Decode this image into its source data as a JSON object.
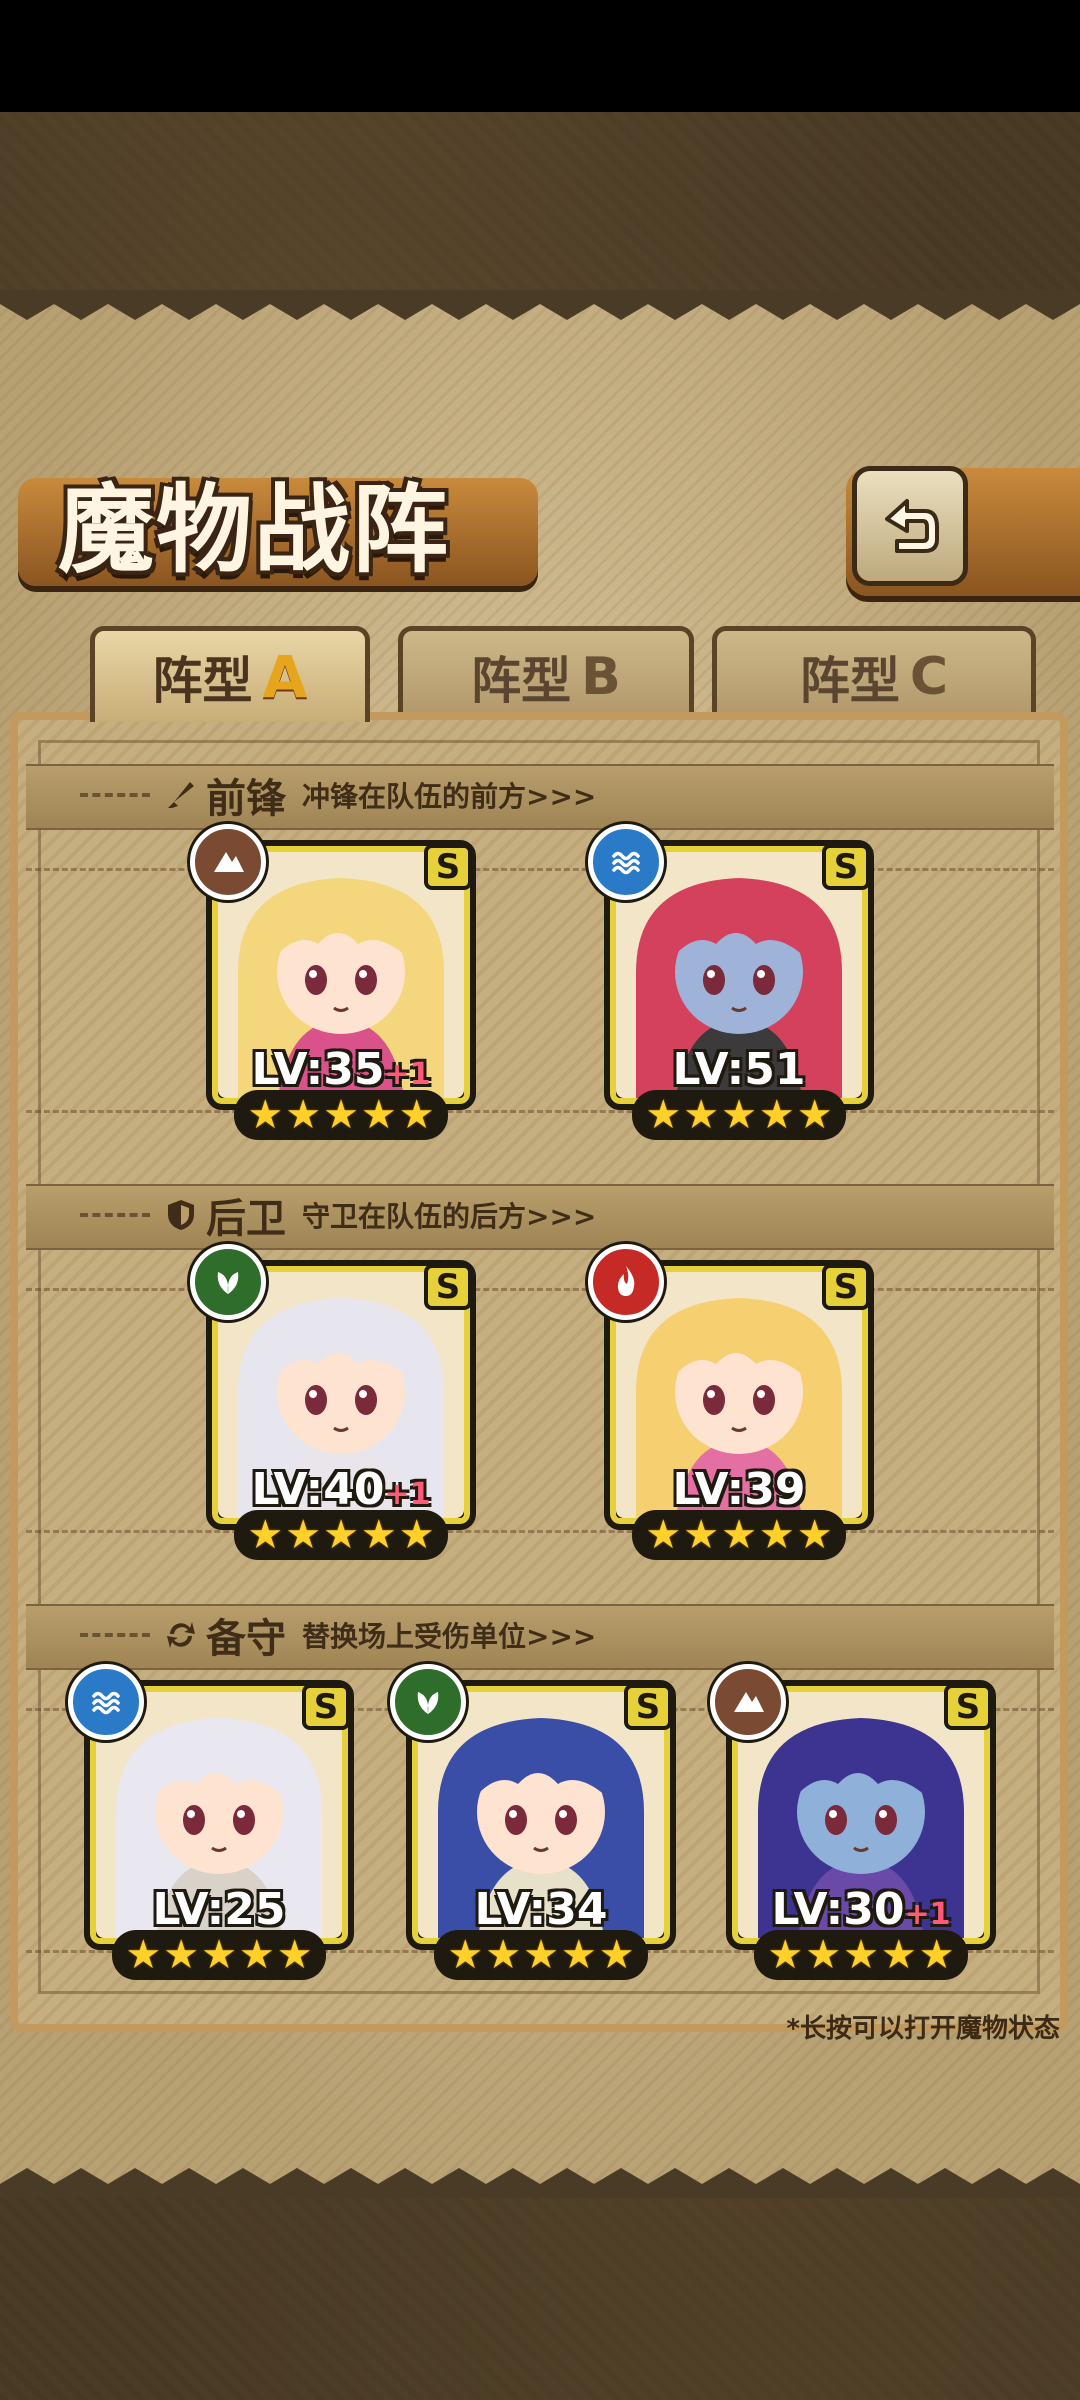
{
  "title": "魔物战阵",
  "back_icon": "back-arrow-icon",
  "tabs": [
    {
      "label": "阵型",
      "letter": "A",
      "active": true
    },
    {
      "label": "阵型",
      "letter": "B",
      "active": false
    },
    {
      "label": "阵型",
      "letter": "C",
      "active": false
    }
  ],
  "sections": {
    "front": {
      "name": "前锋",
      "desc": "冲锋在队伍的前方>>>",
      "icon": "sword-icon"
    },
    "rear": {
      "name": "后卫",
      "desc": "守卫在队伍的后方>>>",
      "icon": "shield-icon"
    },
    "reserve": {
      "name": "备守",
      "desc": "替换场上受伤单位>>>",
      "icon": "swap-icon"
    }
  },
  "units": {
    "front": [
      {
        "level": "LV:35",
        "plus": "+1",
        "rank": "S",
        "element": "earth",
        "stars": 5,
        "hair": "#f4d77c",
        "skin": "#fde3d0",
        "outfit": "#d9538a"
      },
      {
        "level": "LV:51",
        "plus": "",
        "rank": "S",
        "element": "water",
        "stars": 5,
        "hair": "#d4415d",
        "skin": "#9fb3d8",
        "outfit": "#3d3a3c"
      }
    ],
    "rear": [
      {
        "level": "LV:40",
        "plus": "+1",
        "rank": "S",
        "element": "wood",
        "stars": 5,
        "hair": "#e7e6ee",
        "skin": "#fde3d0",
        "outfit": "#e9e5ea"
      },
      {
        "level": "LV:39",
        "plus": "",
        "rank": "S",
        "element": "fire",
        "stars": 5,
        "hair": "#f6cf70",
        "skin": "#fde3d0",
        "outfit": "#e46fa3"
      }
    ],
    "reserve": [
      {
        "level": "LV:25",
        "plus": "",
        "rank": "S",
        "element": "water",
        "stars": 5,
        "hair": "#e9e7ef",
        "skin": "#fde3d0",
        "outfit": "#d8d2c8"
      },
      {
        "level": "LV:34",
        "plus": "",
        "rank": "S",
        "element": "wood",
        "stars": 5,
        "hair": "#3a4ea8",
        "skin": "#fde3d0",
        "outfit": "#e6e1c8"
      },
      {
        "level": "LV:30",
        "plus": "+1",
        "rank": "S",
        "element": "earth",
        "stars": 5,
        "hair": "#3c3490",
        "skin": "#8fb0d8",
        "outfit": "#6a4aa8"
      }
    ]
  },
  "element_colors": {
    "earth": "#7a4a33",
    "water": "#2b7ac8",
    "wood": "#2f6e2a",
    "fire": "#c62a26"
  },
  "hint": "*长按可以打开魔物状态"
}
